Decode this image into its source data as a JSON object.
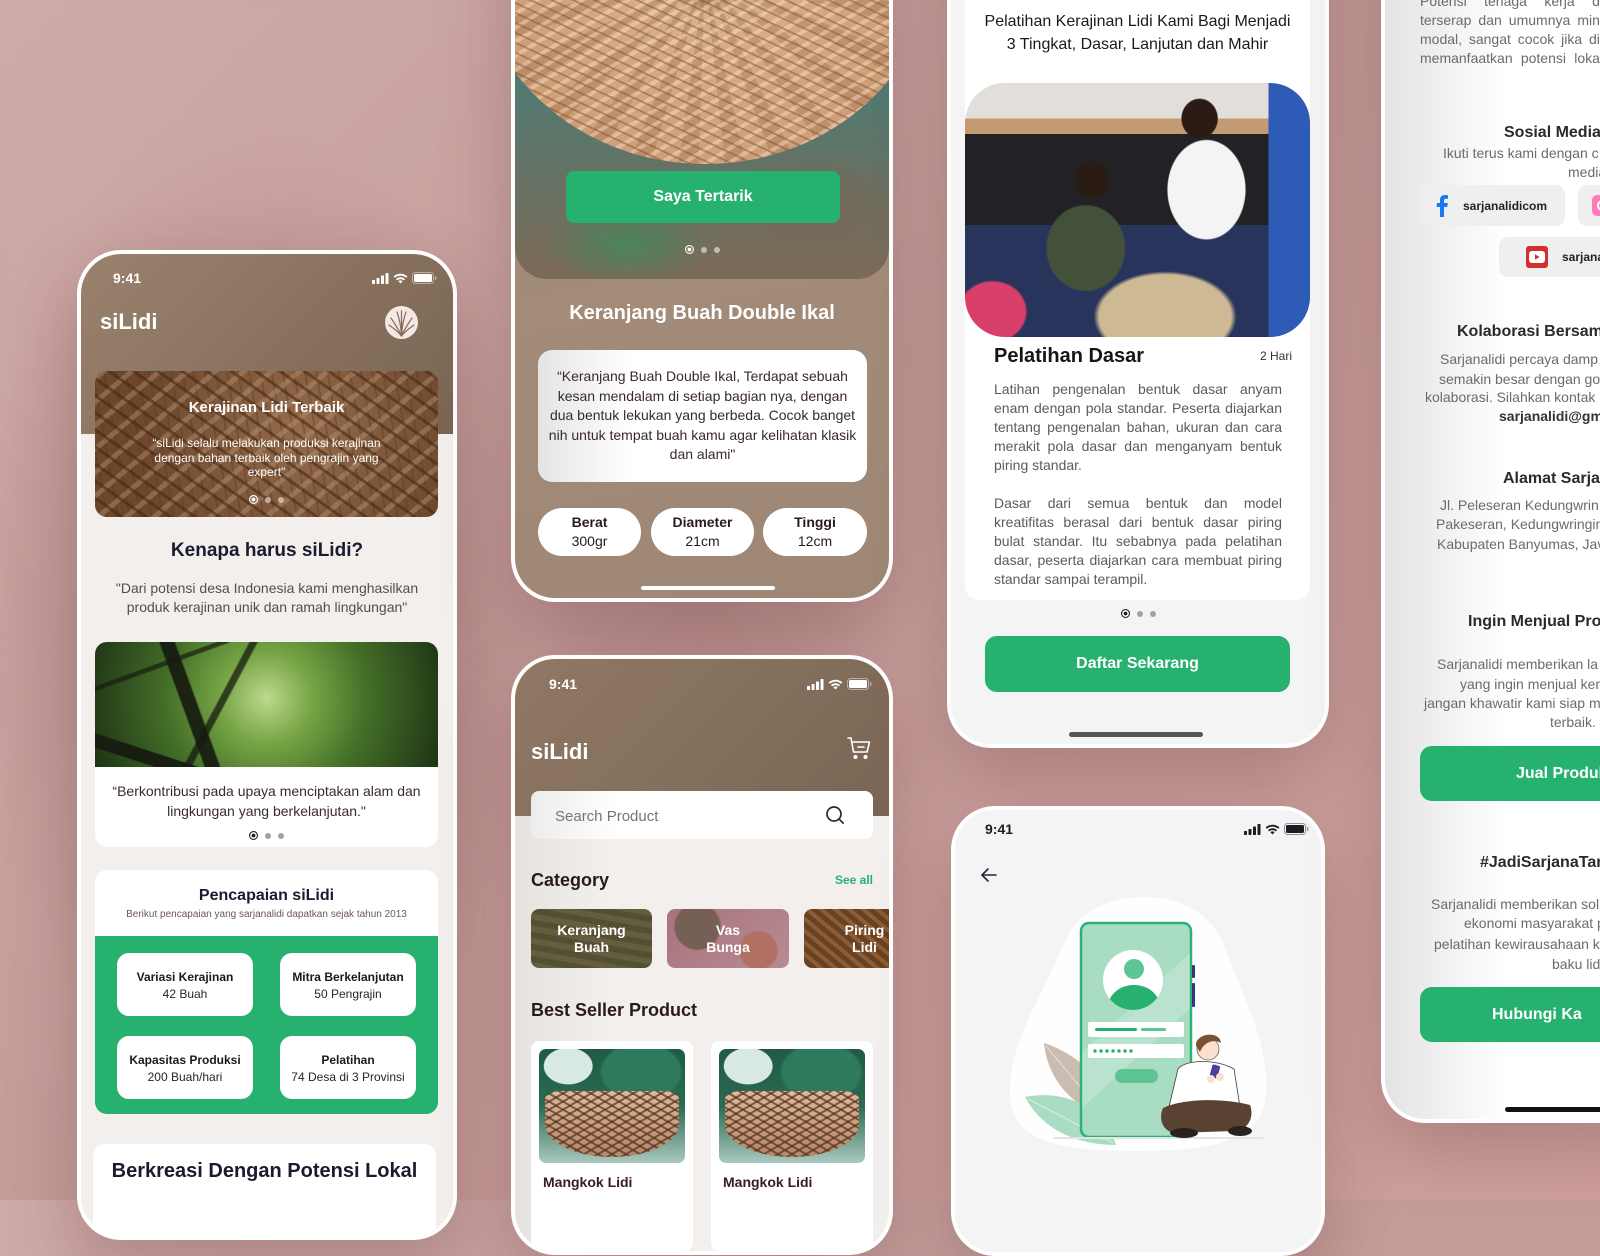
{
  "status_bar": {
    "time": "9:41",
    "icons": [
      "signal-icon",
      "wifi-icon",
      "battery-icon"
    ]
  },
  "colors": {
    "primary_green": "#26B16F",
    "header_brown": "#8C7561",
    "background_mauve": "#C9A09E",
    "heading_text": "#1B1A2E",
    "body_text": "#5B4A4C"
  },
  "home": {
    "app_name": "siLidi",
    "avatar_icon": "lidi-logo-icon",
    "banner": {
      "title": "Kerajinan Lidi Terbaik",
      "quote_lines": [
        "“siLidi selalu melakukan produksi kerajinan",
        "dengan bahan terbaik oleh pengrajin yang",
        "expert\""
      ],
      "carousel": {
        "active": 1,
        "total": 3
      }
    },
    "why": {
      "title": "Kenapa harus siLidi?",
      "quote_lines": [
        "\"Dari potensi desa Indonesia kami menghasilkan",
        "produk kerajinan unik dan ramah lingkungan\""
      ]
    },
    "impact_card": {
      "caption_lines": [
        "“Berkontribusi pada upaya menciptakan alam dan",
        "lingkungan yang berkelanjutan.\""
      ],
      "carousel": {
        "active": 1,
        "total": 3
      }
    },
    "achievements": {
      "title": "Pencapaian siLidi",
      "subtitle": "Berikut pencapaian yang sarjanalidi dapatkan sejak tahun 2013",
      "stats": [
        {
          "label": "Variasi Kerajinan",
          "value": "42 Buah"
        },
        {
          "label": "Mitra Berkelanjutan",
          "value": "50 Pengrajin"
        },
        {
          "label": "Kapasitas Produksi",
          "value": "200 Buah/hari"
        },
        {
          "label": "Pelatihan",
          "value": "74 Desa di 3 Provinsi"
        }
      ]
    },
    "next_section_title": "Berkreasi Dengan Potensi Lokal"
  },
  "product_detail": {
    "cta": "Saya Tertarik",
    "carousel": {
      "active": 1,
      "total": 3
    },
    "title": "Keranjang Buah Double Ikal",
    "description_lines": [
      "“Keranjang Buah Double Ikal, Terdapat sebuah",
      "kesan mendalam di setiap bagian nya, dengan",
      "dua bentuk lekukan yang berbeda. Cocok banget",
      "nih untuk tempat buah kamu agar kelihatan klasik",
      "dan alami\""
    ],
    "specs": [
      {
        "label": "Berat",
        "value": "300gr"
      },
      {
        "label": "Diameter",
        "value": "21cm"
      },
      {
        "label": "Tinggi",
        "value": "12cm"
      }
    ]
  },
  "shop": {
    "app_name": "siLidi",
    "cart_icon": "cart-icon",
    "search": {
      "placeholder": "Search Product",
      "value": ""
    },
    "category_title": "Category",
    "see_all": "See all",
    "categories": [
      {
        "line1": "Keranjang",
        "line2": "Buah"
      },
      {
        "line1": "Vas",
        "line2": "Bunga"
      },
      {
        "line1": "Piring",
        "line2": "Lidi"
      }
    ],
    "best_seller_title": "Best Seller Product",
    "products": [
      {
        "name": "Mangkok Lidi"
      },
      {
        "name": "Mangkok Lidi"
      }
    ]
  },
  "training": {
    "heading_lines": [
      "Pelatihan Kerajinan Lidi Kami Bagi Menjadi",
      "3 Tingkat, Dasar, Lanjutan dan Mahir"
    ],
    "level_title": "Pelatihan Dasar",
    "duration": "2 Hari",
    "paragraphs": [
      [
        "Latihan pengenalan bentuk dasar anyam",
        "enam dengan pola standar. Peserta diajarkan",
        "tentang pengenalan bahan, ukuran dan cara",
        "merakit pola dasar dan menganyam bentuk",
        "piring standar."
      ],
      [
        "Dasar dari semua bentuk dan model",
        "kreatifitas berasal dari bentuk dasar piring",
        "bulat standar. Itu sebabnya pada pelatihan",
        "dasar, peserta diajarkan cara membuat piring",
        "standar sampai terampil."
      ]
    ],
    "carousel": {
      "active": 1,
      "total": 3
    },
    "cta": "Daftar Sekarang"
  },
  "login": {
    "back_icon": "arrow-left-icon",
    "illustration": "login-phone-illustration"
  },
  "about": {
    "intro_lines": [
      "Potensi tenaga kerja di",
      "terserap dan umumnya mini",
      "modal, sangat cocok jika dil",
      "memanfaatkan potensi lokal"
    ],
    "social": {
      "title": "Sosial Media",
      "desc_lines": [
        "Ikuti terus kami dengan c",
        "media kam"
      ],
      "facebook": "sarjanalidicom",
      "youtube": "sarjana"
    },
    "collab": {
      "title": "Kolaborasi Bersama",
      "lines": [
        "Sarjanalidi percaya damp",
        "semakin besar dengan go",
        "kolaborasi. Silahkan kontak"
      ],
      "email": "sarjanalidi@gm"
    },
    "address": {
      "title": "Alamat Sarja",
      "lines": [
        "Jl. Peleseran Kedungwrin",
        "Pakeseran, Kedungwringin",
        "Kabupaten Banyumas, Jav"
      ]
    },
    "sell": {
      "title": "Ingin Menjual Pro",
      "lines": [
        "Sarjanalidi memberikan la",
        "yang ingin menjual kerajin",
        "jangan khawatir kami siap m",
        "terbaik."
      ],
      "cta": "Jual Produk"
    },
    "hashtag": {
      "title": "#JadiSarjanaTan",
      "lines": [
        "Sarjanalidi memberikan sol",
        "ekonomi masyarakat pe",
        "pelatihan kewirausahaan k",
        "baku lidi kel"
      ],
      "cta": "Hubungi Ka"
    }
  }
}
